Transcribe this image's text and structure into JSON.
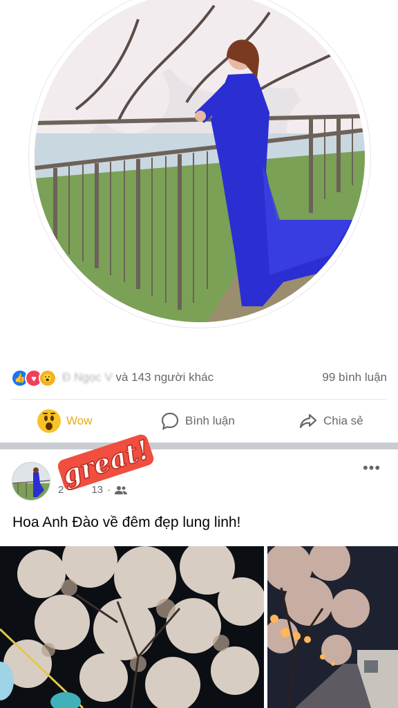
{
  "reactions": {
    "types": [
      "like-icon",
      "love-icon",
      "wow-icon"
    ],
    "names_blurred": "Đ    Ngọc  V",
    "summary": "và 143 người khác",
    "comment_count": "99 bình luận"
  },
  "actions": {
    "wow_label": "Wow",
    "comment_label": "Bình luận",
    "share_label": "Chia sẻ"
  },
  "post": {
    "sticker_text": "great!",
    "date": "2",
    "date_tail": "13",
    "audience_icon": "friends-icon",
    "text": "Hoa Anh Đào về đêm đẹp lung linh!",
    "more_label": "•••"
  },
  "colors": {
    "accent_blue": "#1877f2",
    "love_red": "#f33e58",
    "wow_yellow": "#f7b125",
    "muted_text": "#65676b",
    "separator": "#c9ccd1"
  }
}
